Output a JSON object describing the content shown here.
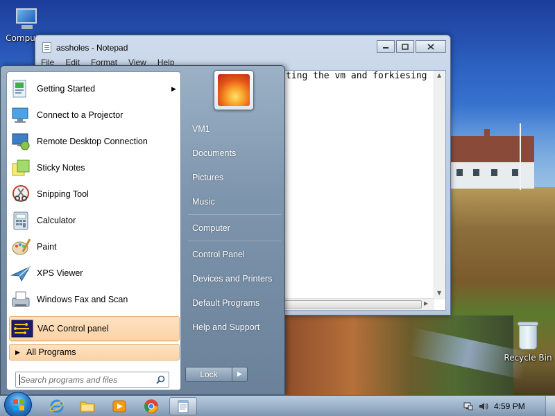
{
  "desktop": {
    "icons": [
      {
        "label": "Computer"
      },
      {
        "label": "Recycle Bin"
      }
    ]
  },
  "notepad": {
    "title": "assholes - Notepad",
    "menu": [
      "File",
      "Edit",
      "Format",
      "View",
      "Help"
    ],
    "content": "ting the vm and forkiesing",
    "minimize_icon": "minimize-icon",
    "maximize_icon": "maximize-icon",
    "close_icon": "close-icon"
  },
  "start_menu": {
    "programs": [
      {
        "label": "Getting Started",
        "icon": "getting-started-icon",
        "submenu": true
      },
      {
        "label": "Connect to a Projector",
        "icon": "projector-icon"
      },
      {
        "label": "Remote Desktop Connection",
        "icon": "remote-desktop-icon"
      },
      {
        "label": "Sticky Notes",
        "icon": "sticky-notes-icon"
      },
      {
        "label": "Snipping Tool",
        "icon": "snipping-tool-icon"
      },
      {
        "label": "Calculator",
        "icon": "calculator-icon"
      },
      {
        "label": "Paint",
        "icon": "paint-icon"
      },
      {
        "label": "XPS Viewer",
        "icon": "xps-viewer-icon"
      },
      {
        "label": "Windows Fax and Scan",
        "icon": "fax-scan-icon"
      },
      {
        "label": "VAC Control panel",
        "icon": "vac-control-panel-icon",
        "highlighted": true
      }
    ],
    "all_programs": "All Programs",
    "search_placeholder": "Search programs and files",
    "right_links": [
      "VM1",
      "Documents",
      "Pictures",
      "Music",
      "Computer",
      "Control Panel",
      "Devices and Printers",
      "Default Programs",
      "Help and Support"
    ],
    "lock_label": "Lock"
  },
  "taskbar": {
    "pinned": [
      "internet-explorer-icon",
      "windows-explorer-icon",
      "media-player-icon",
      "chrome-icon",
      "notepad-icon"
    ],
    "clock": "4:59 PM",
    "tray_icons": [
      "network-icon",
      "volume-icon"
    ]
  },
  "colors": {
    "highlight": "#fbd3a6",
    "taskbar": "#96afc8",
    "start_orb": "#2a7fd1"
  }
}
